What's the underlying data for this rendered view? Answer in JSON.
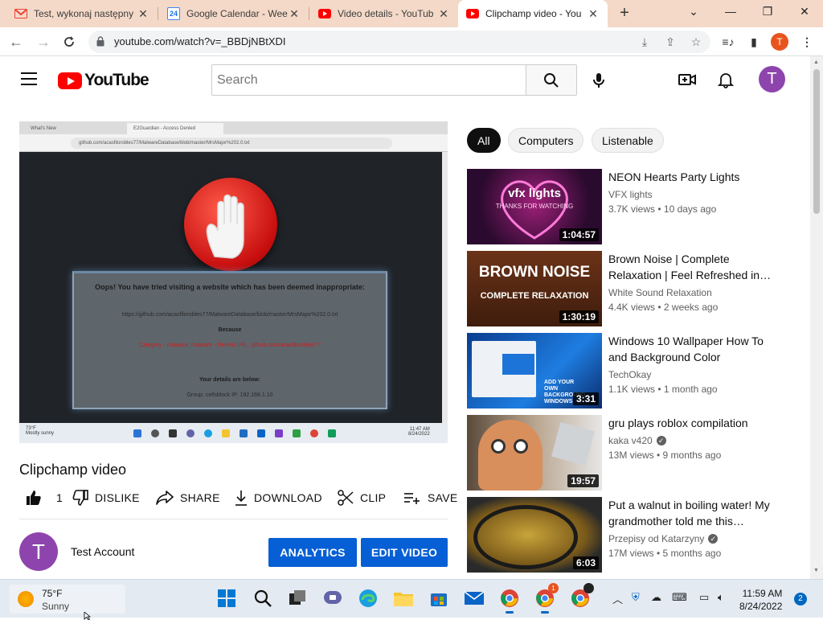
{
  "browser": {
    "tabs": [
      {
        "title": "Test, wykonaj następny",
        "icon": "gmail-icon"
      },
      {
        "title": "Google Calendar - Wee",
        "icon": "calendar-icon"
      },
      {
        "title": "Video details - YouTub",
        "icon": "youtube-icon"
      },
      {
        "title": "Clipchamp video - You",
        "icon": "youtube-icon"
      }
    ],
    "calendar_day": "24",
    "url": "youtube.com/watch?v=_BBDjNBtXDI",
    "profile_letter": "T"
  },
  "youtube": {
    "logo_text": "YouTube",
    "search_placeholder": "Search",
    "avatar_letter": "T"
  },
  "player": {
    "rec_tabs": [
      "What's New",
      "E2Guardian - Access Denied"
    ],
    "rec_url": "github.com/acasfilorobles77/MalwareDatabase/blob/master/MrsMajor%202.0.txt",
    "block_line1": "Oops! You have tried visiting a website which has been deemed inappropriate:",
    "block_line2": "https://github.com/acasfilorobles77/MalwareDatabase/blob/master/MrsMajor%202.0.txt",
    "block_line3": "Because",
    "block_line4": "Category - malware, malware - Denied URL: github.com/acasfilorobles77",
    "block_line5": "Your details are below:",
    "block_line6": "Group: cellsblock   IP: 192.168.1.10",
    "rec_weather": "73°F",
    "rec_weather2": "Mostly sunny",
    "rec_time": "11:47 AM",
    "rec_date": "8/24/2022"
  },
  "video": {
    "title": "Clipchamp video",
    "like_count": "1",
    "dislike_label": "DISLIKE",
    "share_label": "SHARE",
    "download_label": "DOWNLOAD",
    "clip_label": "CLIP",
    "save_label": "SAVE",
    "channel_name": "Test Account",
    "channel_letter": "T",
    "analytics_label": "ANALYTICS",
    "edit_label": "EDIT VIDEO"
  },
  "chips": [
    "All",
    "Computers",
    "Listenable"
  ],
  "suggestions": [
    {
      "title": "NEON Hearts Party Lights",
      "channel": "VFX lights",
      "verified": false,
      "meta": "3.7K views • 10 days ago",
      "duration": "1:04:57",
      "thumb_text1": "vfx lights",
      "thumb_text2": "THANKS FOR WATCHING"
    },
    {
      "title": "Brown Noise | Complete Relaxation | Feel Refreshed in…",
      "channel": "White Sound Relaxation",
      "verified": false,
      "meta": "4.4K views • 2 weeks ago",
      "duration": "1:30:19",
      "thumb_text1": "BROWN NOISE",
      "thumb_text2": "COMPLETE RELAXATION"
    },
    {
      "title": "Windows 10 Wallpaper How To and Background Color",
      "channel": "TechOkay",
      "verified": false,
      "meta": "1.1K views • 1 month ago",
      "duration": "3:31",
      "thumb_text1": "ADD YOUR OWN BACKGROUND WINDOWS",
      "thumb_text2": ""
    },
    {
      "title": "gru plays roblox compilation",
      "channel": "kaka v420",
      "verified": true,
      "meta": "13M views • 9 months ago",
      "duration": "19:57",
      "thumb_text1": "",
      "thumb_text2": ""
    },
    {
      "title": "Put a walnut in boiling water! My grandmother told me this…",
      "channel": "Przepisy od Katarzyny",
      "verified": true,
      "meta": "17M views • 5 months ago",
      "duration": "6:03",
      "thumb_text1": "",
      "thumb_text2": ""
    }
  ],
  "taskbar": {
    "weather_temp": "75°F",
    "weather_desc": "Sunny",
    "time": "11:59 AM",
    "date": "8/24/2022",
    "notifications": "2",
    "chrome_badge": "1"
  },
  "colors": {
    "accent": "#065fd4",
    "youtube_red": "#ff0000",
    "tabstrip": "#f4d9c8"
  }
}
